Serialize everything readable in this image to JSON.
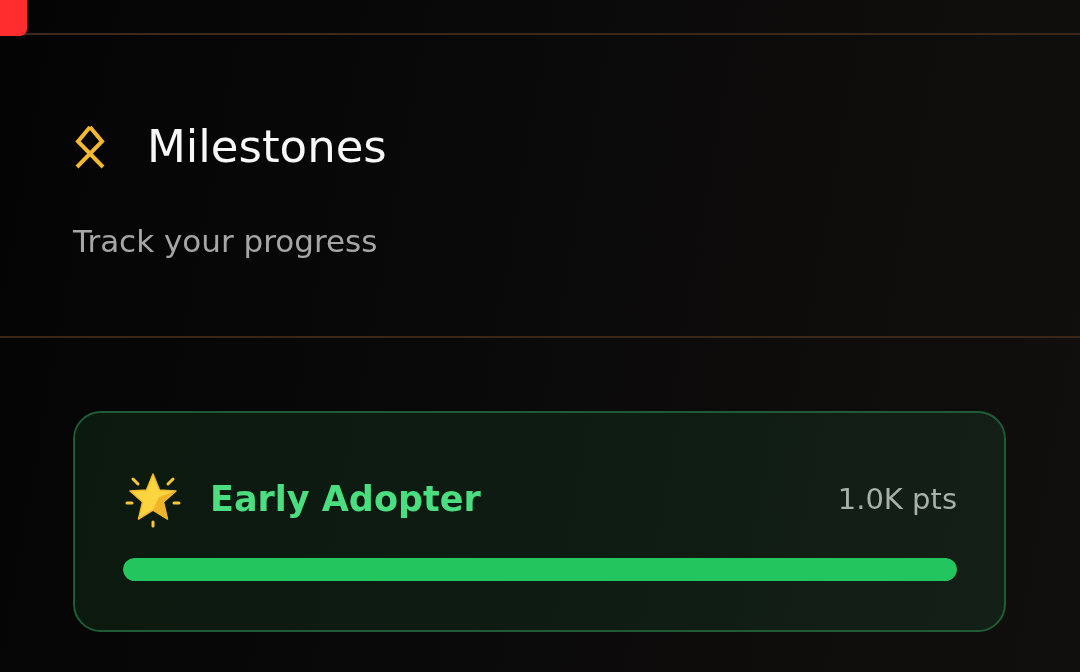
{
  "header": {
    "title": "Milestones",
    "subtitle": "Track your progress"
  },
  "milestones": [
    {
      "title": "Early Adopter",
      "points": "1.0K pts",
      "level": 1,
      "completed": true
    }
  ]
}
